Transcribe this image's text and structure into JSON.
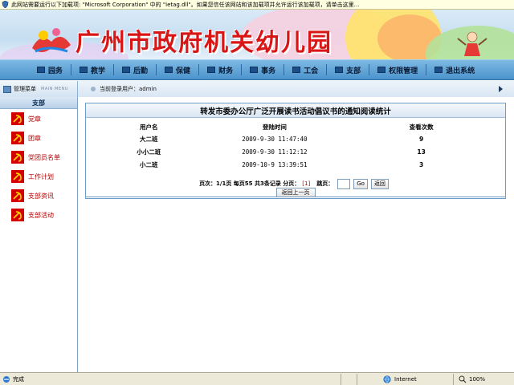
{
  "infobar": {
    "message": "此网站需要运行以下加载项: \"Microsoft Corporation\" 中的 \"ietag.dll\"。如果您信任该网站和该加载项并允许运行该加载项，请单击这里..."
  },
  "banner": {
    "title": "广州市政府机关幼儿园"
  },
  "nav": {
    "items": [
      {
        "label": "园务"
      },
      {
        "label": "教学"
      },
      {
        "label": "后勤"
      },
      {
        "label": "保健"
      },
      {
        "label": "财务"
      },
      {
        "label": "事务"
      },
      {
        "label": "工会"
      },
      {
        "label": "支部"
      },
      {
        "label": "权限管理"
      },
      {
        "label": "退出系统"
      }
    ]
  },
  "subbar": {
    "menu_label": "管理菜单",
    "menu_sub": "MAIN MENU",
    "current_user_label": "当前登录用户：",
    "current_user": "admin"
  },
  "sidebar": {
    "section": "支部",
    "items": [
      {
        "label": "党章"
      },
      {
        "label": "团章"
      },
      {
        "label": "党团员名单"
      },
      {
        "label": "工作计划"
      },
      {
        "label": "支部资讯"
      },
      {
        "label": "支部活动"
      }
    ]
  },
  "main": {
    "title": "转发市委办公厅广泛开展读书活动倡议书的通知阅读统计",
    "columns": [
      "用户名",
      "登陆时间",
      "查看次数"
    ],
    "rows": [
      {
        "user": "大二班",
        "time": "2009-9-30 11:47:40",
        "count": "9"
      },
      {
        "user": "小小二班",
        "time": "2009-9-30 11:12:12",
        "count": "13"
      },
      {
        "user": "小二班",
        "time": "2009-10-9 13:39:51",
        "count": "3"
      }
    ],
    "pager": {
      "text": "页次：1/1页 每页55 共3条记录 分页：",
      "current": "[1]",
      "jump_label": "跳页：",
      "go": "Go",
      "back": "返回"
    },
    "back_button": "返回上一页"
  },
  "status": {
    "done": "完成",
    "zone": "Internet",
    "zoom": "100%"
  },
  "colors": {
    "nav_bg": "#4c93cc",
    "sidebar_text": "#b10000",
    "title_red": "#d81616"
  }
}
